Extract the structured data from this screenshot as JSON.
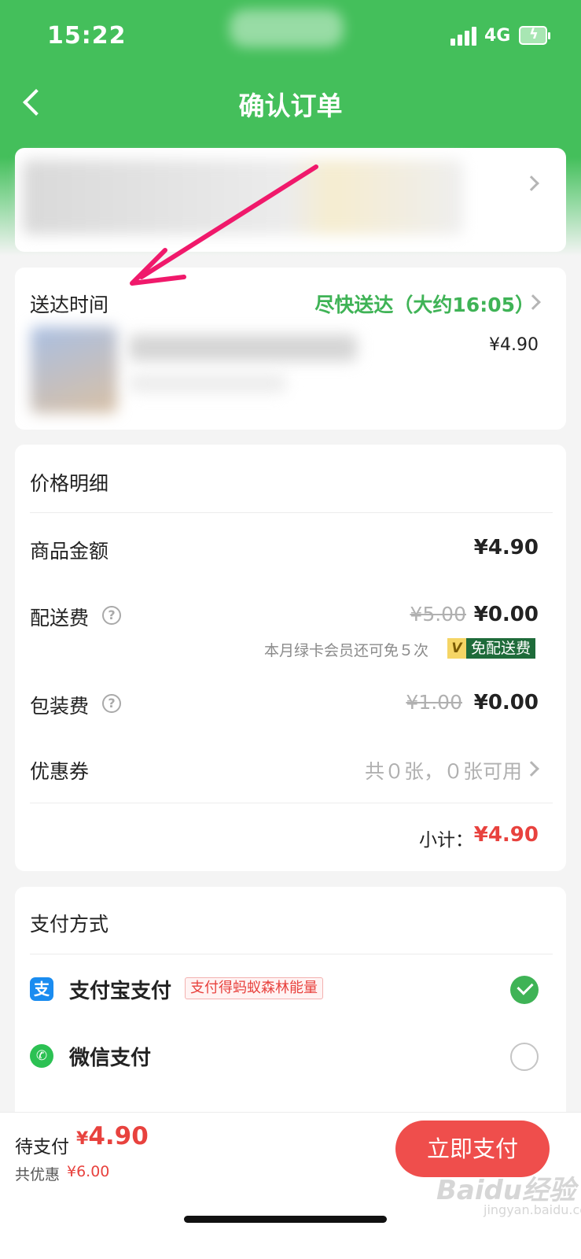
{
  "status_bar": {
    "time": "15:22",
    "network": "4G",
    "battery_charging": true
  },
  "nav": {
    "title": "确认订单",
    "back_icon": "chevron-left-icon"
  },
  "delivery": {
    "label": "送达时间",
    "value": "尽快送达（大约16:05）",
    "item_price": "¥4.90"
  },
  "price_detail": {
    "title": "价格明细",
    "goods": {
      "label": "商品金额",
      "value": "¥4.90"
    },
    "shipping": {
      "label": "配送费",
      "original": "¥5.00",
      "value": "¥0.00",
      "member_note": "本月绿卡会员还可免５次",
      "v_badge": "V",
      "free_badge": "免配送费"
    },
    "packing": {
      "label": "包装费",
      "original": "¥1.00",
      "value": "¥0.00"
    },
    "coupon": {
      "label": "优惠券",
      "value": "共０张，０张可用"
    },
    "subtotal": {
      "label": "小计：",
      "value": "¥4.90"
    }
  },
  "payment": {
    "title": "支付方式",
    "methods": [
      {
        "name": "支付宝支付",
        "icon": "alipay-icon",
        "glyph": "支",
        "tag": "支付得蚂蚁森林能量",
        "selected": true
      },
      {
        "name": "微信支付",
        "icon": "wechat-icon",
        "glyph": "✆",
        "selected": false
      }
    ]
  },
  "bottom_bar": {
    "pending_label": "待支付",
    "pending_currency": "¥",
    "pending_amount": "4.90",
    "discount_label": "共优惠",
    "discount_amount": "¥6.00",
    "pay_button": "立即支付"
  },
  "watermark": {
    "brand": "Baidu经验",
    "url": "jingyan.baidu.com"
  },
  "colors": {
    "brand_green": "#44bf5b",
    "accent_red": "#e8423e",
    "member_dark": "#1e6b3a"
  }
}
